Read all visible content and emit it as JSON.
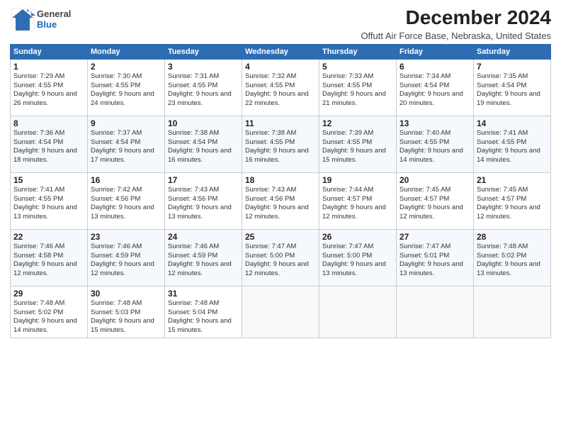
{
  "logo": {
    "general": "General",
    "blue": "Blue"
  },
  "title": "December 2024",
  "subtitle": "Offutt Air Force Base, Nebraska, United States",
  "weekdays": [
    "Sunday",
    "Monday",
    "Tuesday",
    "Wednesday",
    "Thursday",
    "Friday",
    "Saturday"
  ],
  "weeks": [
    [
      {
        "day": 1,
        "sunrise": "7:29 AM",
        "sunset": "4:55 PM",
        "daylight": "9 hours and 26 minutes."
      },
      {
        "day": 2,
        "sunrise": "7:30 AM",
        "sunset": "4:55 PM",
        "daylight": "9 hours and 24 minutes."
      },
      {
        "day": 3,
        "sunrise": "7:31 AM",
        "sunset": "4:55 PM",
        "daylight": "9 hours and 23 minutes."
      },
      {
        "day": 4,
        "sunrise": "7:32 AM",
        "sunset": "4:55 PM",
        "daylight": "9 hours and 22 minutes."
      },
      {
        "day": 5,
        "sunrise": "7:33 AM",
        "sunset": "4:55 PM",
        "daylight": "9 hours and 21 minutes."
      },
      {
        "day": 6,
        "sunrise": "7:34 AM",
        "sunset": "4:54 PM",
        "daylight": "9 hours and 20 minutes."
      },
      {
        "day": 7,
        "sunrise": "7:35 AM",
        "sunset": "4:54 PM",
        "daylight": "9 hours and 19 minutes."
      }
    ],
    [
      {
        "day": 8,
        "sunrise": "7:36 AM",
        "sunset": "4:54 PM",
        "daylight": "9 hours and 18 minutes."
      },
      {
        "day": 9,
        "sunrise": "7:37 AM",
        "sunset": "4:54 PM",
        "daylight": "9 hours and 17 minutes."
      },
      {
        "day": 10,
        "sunrise": "7:38 AM",
        "sunset": "4:54 PM",
        "daylight": "9 hours and 16 minutes."
      },
      {
        "day": 11,
        "sunrise": "7:38 AM",
        "sunset": "4:55 PM",
        "daylight": "9 hours and 16 minutes."
      },
      {
        "day": 12,
        "sunrise": "7:39 AM",
        "sunset": "4:55 PM",
        "daylight": "9 hours and 15 minutes."
      },
      {
        "day": 13,
        "sunrise": "7:40 AM",
        "sunset": "4:55 PM",
        "daylight": "9 hours and 14 minutes."
      },
      {
        "day": 14,
        "sunrise": "7:41 AM",
        "sunset": "4:55 PM",
        "daylight": "9 hours and 14 minutes."
      }
    ],
    [
      {
        "day": 15,
        "sunrise": "7:41 AM",
        "sunset": "4:55 PM",
        "daylight": "9 hours and 13 minutes."
      },
      {
        "day": 16,
        "sunrise": "7:42 AM",
        "sunset": "4:56 PM",
        "daylight": "9 hours and 13 minutes."
      },
      {
        "day": 17,
        "sunrise": "7:43 AM",
        "sunset": "4:56 PM",
        "daylight": "9 hours and 13 minutes."
      },
      {
        "day": 18,
        "sunrise": "7:43 AM",
        "sunset": "4:56 PM",
        "daylight": "9 hours and 12 minutes."
      },
      {
        "day": 19,
        "sunrise": "7:44 AM",
        "sunset": "4:57 PM",
        "daylight": "9 hours and 12 minutes."
      },
      {
        "day": 20,
        "sunrise": "7:45 AM",
        "sunset": "4:57 PM",
        "daylight": "9 hours and 12 minutes."
      },
      {
        "day": 21,
        "sunrise": "7:45 AM",
        "sunset": "4:57 PM",
        "daylight": "9 hours and 12 minutes."
      }
    ],
    [
      {
        "day": 22,
        "sunrise": "7:46 AM",
        "sunset": "4:58 PM",
        "daylight": "9 hours and 12 minutes."
      },
      {
        "day": 23,
        "sunrise": "7:46 AM",
        "sunset": "4:59 PM",
        "daylight": "9 hours and 12 minutes."
      },
      {
        "day": 24,
        "sunrise": "7:46 AM",
        "sunset": "4:59 PM",
        "daylight": "9 hours and 12 minutes."
      },
      {
        "day": 25,
        "sunrise": "7:47 AM",
        "sunset": "5:00 PM",
        "daylight": "9 hours and 12 minutes."
      },
      {
        "day": 26,
        "sunrise": "7:47 AM",
        "sunset": "5:00 PM",
        "daylight": "9 hours and 13 minutes."
      },
      {
        "day": 27,
        "sunrise": "7:47 AM",
        "sunset": "5:01 PM",
        "daylight": "9 hours and 13 minutes."
      },
      {
        "day": 28,
        "sunrise": "7:48 AM",
        "sunset": "5:02 PM",
        "daylight": "9 hours and 13 minutes."
      }
    ],
    [
      {
        "day": 29,
        "sunrise": "7:48 AM",
        "sunset": "5:02 PM",
        "daylight": "9 hours and 14 minutes."
      },
      {
        "day": 30,
        "sunrise": "7:48 AM",
        "sunset": "5:03 PM",
        "daylight": "9 hours and 15 minutes."
      },
      {
        "day": 31,
        "sunrise": "7:48 AM",
        "sunset": "5:04 PM",
        "daylight": "9 hours and 15 minutes."
      },
      null,
      null,
      null,
      null
    ]
  ],
  "labels": {
    "sunrise": "Sunrise:",
    "sunset": "Sunset:",
    "daylight": "Daylight:"
  }
}
